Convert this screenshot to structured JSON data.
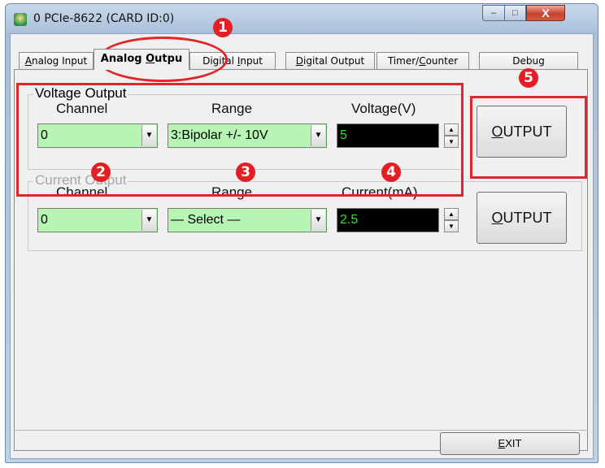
{
  "window": {
    "title": "0 PCIe-8622 (CARD ID:0)",
    "minimize_glyph": "–",
    "maximize_glyph": "□",
    "close_glyph": "X"
  },
  "tabs": [
    {
      "label": "Analog Input",
      "underline": "A",
      "rest": "nalog Input"
    },
    {
      "label": "Analog Output",
      "shown": "Analog Outpu",
      "pre": "Analog ",
      "underline": "O",
      "rest": "utpu"
    },
    {
      "label": "Digital Input",
      "pre": "Digital ",
      "underline": "I",
      "rest": "nput"
    },
    {
      "label": "Digital Output",
      "underline": "D",
      "rest": "igital Output"
    },
    {
      "label": "Timer/Counter",
      "pre": "Timer/",
      "underline": "C",
      "rest": "ounter"
    },
    {
      "label": "Debug"
    }
  ],
  "voltage_output": {
    "group_title": "Voltage Output",
    "channel_label": "Channel",
    "range_label": "Range",
    "value_label": "Voltage(V)",
    "channel_value": "0",
    "range_value": "3:Bipolar +/-  10V",
    "value": "5",
    "button": {
      "underline": "O",
      "rest": "UTPUT"
    }
  },
  "current_output": {
    "group_title": "Current Output",
    "channel_label": "Channel",
    "range_label": "Range",
    "value_label": "Current(mA)",
    "channel_value": "0",
    "range_value": "— Select —",
    "value": "2.5",
    "button": {
      "underline": "O",
      "rest": "UTPUT"
    }
  },
  "exit_button": {
    "underline": "E",
    "rest": "XIT"
  },
  "annotations": {
    "markers": [
      "1",
      "2",
      "3",
      "4",
      "5"
    ],
    "color": "#e31e24"
  },
  "colors": {
    "combo_bg": "#b7f5b4",
    "numfield_bg": "#000000",
    "numfield_text": "#2be32b"
  }
}
